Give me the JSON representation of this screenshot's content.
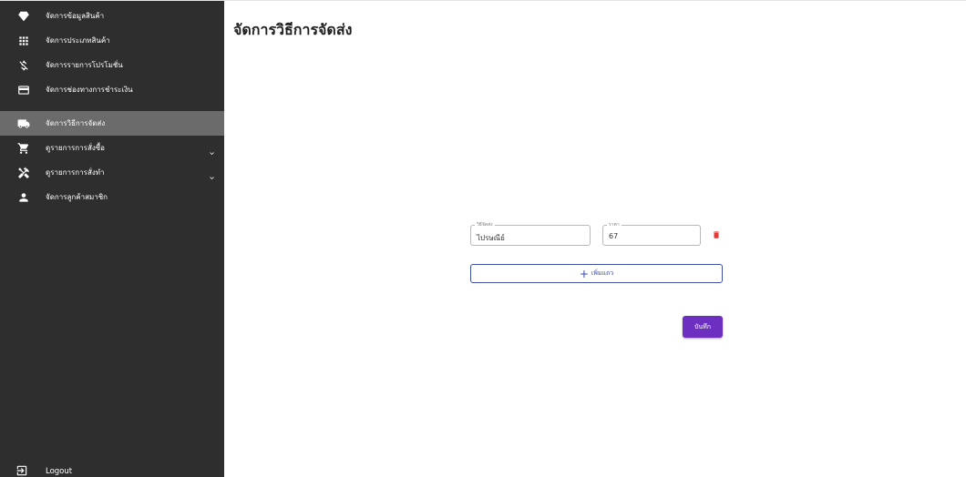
{
  "sidebar": {
    "items": [
      {
        "label": "จัดการข้อมูลสินค้า",
        "icon": "diamond-icon",
        "active": false,
        "expandable": false
      },
      {
        "label": "จัดการประเภทสินค้า",
        "icon": "grid-icon",
        "active": false,
        "expandable": false
      },
      {
        "label": "จัดการรายการโปรโมชั่น",
        "icon": "money-off-icon",
        "active": false,
        "expandable": false
      },
      {
        "label": "จัดการช่องทางการชำระเงิน",
        "icon": "credit-card-icon",
        "active": false,
        "expandable": false
      },
      {
        "label": "จัดการวิธีการจัดส่ง",
        "icon": "truck-icon",
        "active": true,
        "expandable": false
      },
      {
        "label": "ดูรายการการสั่งซื้อ",
        "icon": "cart-icon",
        "active": false,
        "expandable": true
      },
      {
        "label": "ดูรายการการสั่งทำ",
        "icon": "tools-icon",
        "active": false,
        "expandable": true
      },
      {
        "label": "จัดการลูกค้าสมาชิก",
        "icon": "person-icon",
        "active": false,
        "expandable": false
      }
    ],
    "logout_label": "Logout"
  },
  "main": {
    "title": "จัดการวิธีการจัดส่ง",
    "shipping_method": {
      "legend": "วิธีจัดส่ง",
      "value": "ไปรษณีย์"
    },
    "price": {
      "legend": "ราคา",
      "value": "67"
    },
    "add_row_label": "เพิ่มแถว",
    "save_label": "บันทึก"
  },
  "colors": {
    "sidebar_bg": "#2e2e2e",
    "active_item_bg": "#6b6b6b",
    "primary_button": "#6c2fbf",
    "outline_button": "#3949ab",
    "delete_icon": "#e53935"
  }
}
